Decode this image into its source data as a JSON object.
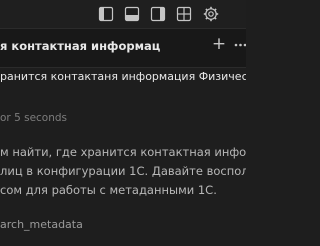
{
  "colors": {
    "background": "#1e1e1e",
    "titlebar": "#1f1f1f",
    "panel": "#181818",
    "text_primary": "#e8e8e8",
    "text_secondary": "#b8b8b8",
    "text_muted": "#7d7d7d",
    "icon": "#c5c5c5"
  },
  "titlebar": {
    "icons": [
      "toggle-primary-sidebar-icon",
      "toggle-panel-icon",
      "toggle-secondary-sidebar-icon",
      "customize-layout-icon",
      "settings-gear-icon"
    ]
  },
  "chat": {
    "title": "я контактная информац",
    "new_chat_label": "+",
    "user_message": "ранится контактаня информация Физических",
    "thought_label": "or 5 seconds",
    "reply_lines": [
      "м найти, где хранится контактная информ",
      "лиц в конфигурации 1С. Давайте воспол",
      "сом для работы с метаданными 1С."
    ],
    "tool_label": "arch_metadata"
  }
}
